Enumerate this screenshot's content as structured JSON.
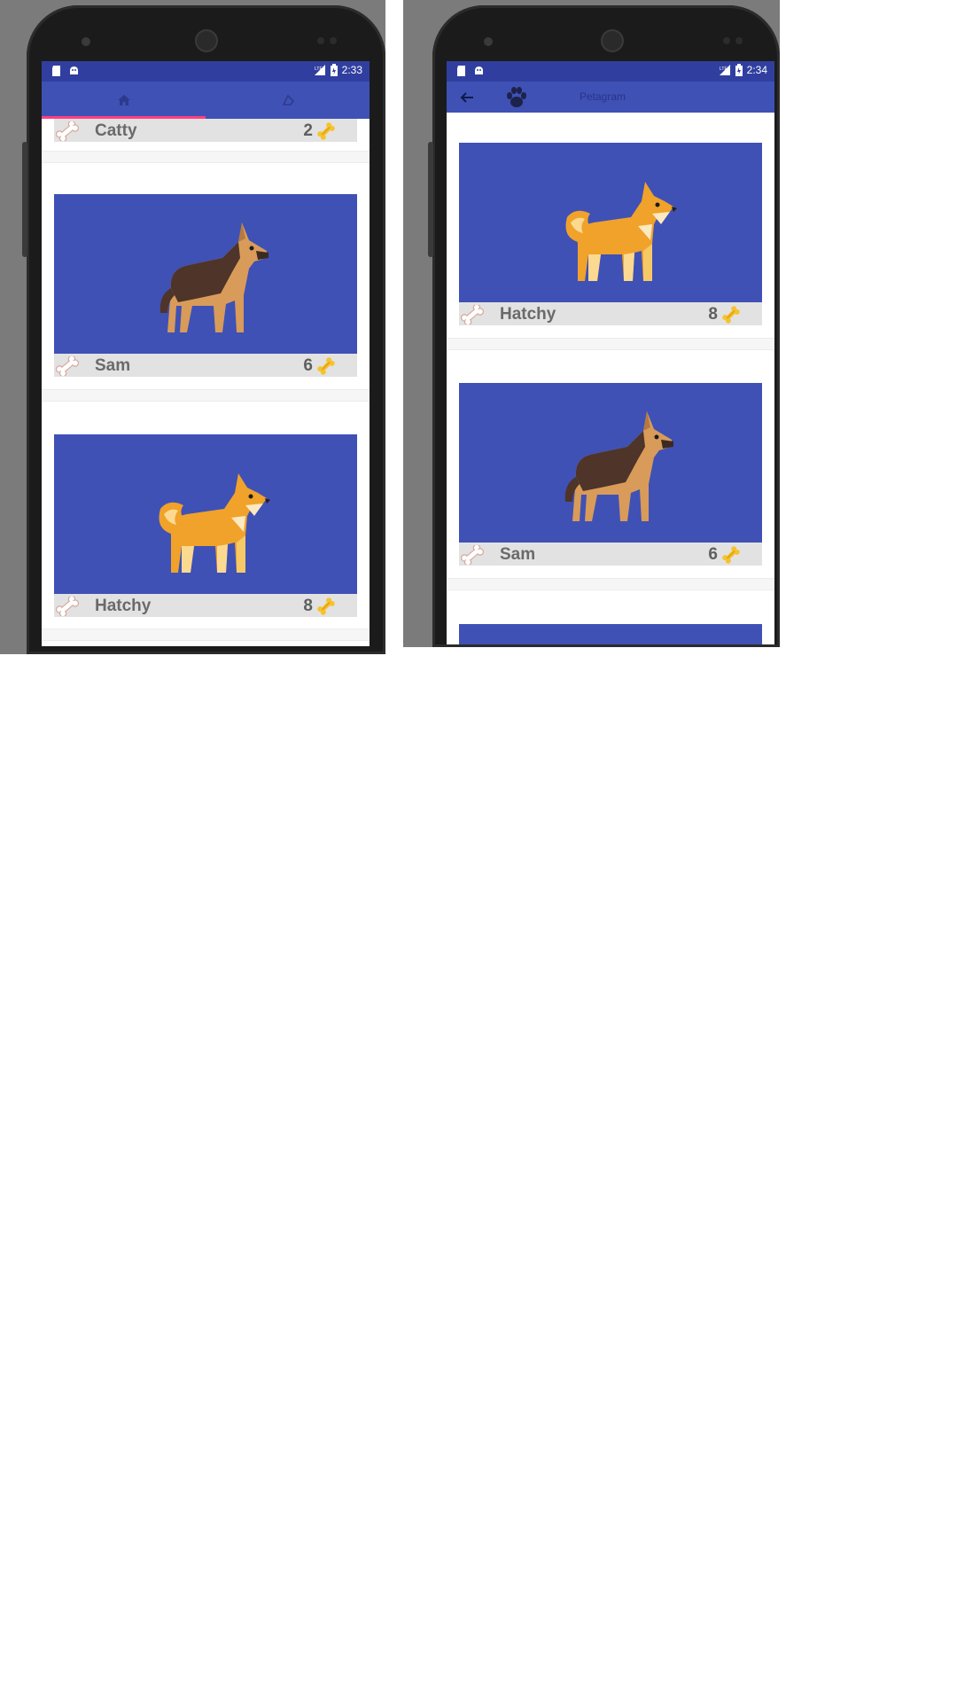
{
  "left_phone": {
    "status": {
      "time": "2:33",
      "network": "LTE"
    },
    "tabs": [
      {
        "icon": "home-icon",
        "selected": true
      },
      {
        "icon": "dog-icon",
        "selected": false
      }
    ],
    "pets": [
      {
        "name": "Catty",
        "likes": "2"
      },
      {
        "name": "Sam",
        "likes": "6",
        "breed_icon": "german-shepherd-icon"
      },
      {
        "name": "Hatchy",
        "likes": "8",
        "breed_icon": "shiba-icon"
      }
    ]
  },
  "right_phone": {
    "status": {
      "time": "2:34",
      "network": "LTE"
    },
    "appbar": {
      "title": "Petagram",
      "back_icon": "arrow-back-icon",
      "logo_icon": "paw-icon"
    },
    "pets": [
      {
        "name": "Hatchy",
        "likes": "8",
        "breed_icon": "shiba-icon"
      },
      {
        "name": "Sam",
        "likes": "6",
        "breed_icon": "german-shepherd-icon"
      }
    ]
  },
  "colors": {
    "primary": "#3f51b5",
    "primary_dark": "#303f9f",
    "accent": "#ff4081",
    "footer": "#e2e2e2",
    "bone_gold": "#f5c32c"
  }
}
